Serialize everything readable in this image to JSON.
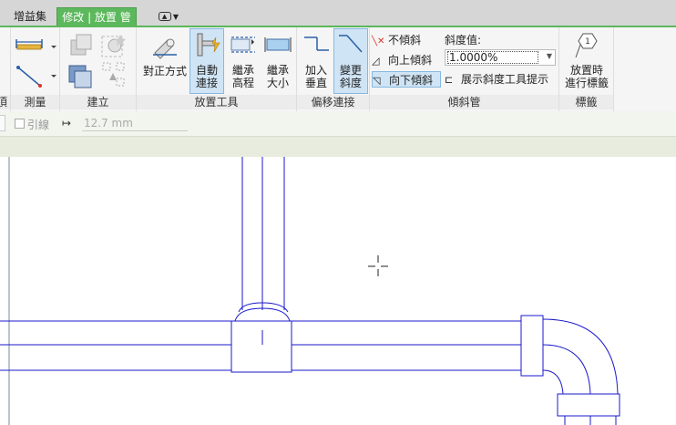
{
  "tabs": {
    "addins": "增益集",
    "modify": "修改 | 放置 管"
  },
  "ribbon": {
    "measure_label": "測量",
    "create_label": "建立",
    "clip_label": "頂",
    "placement_tools": {
      "label": "放置工具",
      "justification": "對正方式",
      "auto_connect_1": "自動",
      "auto_connect_2": "連接",
      "inherit_elev_1": "繼承",
      "inherit_elev_2": "高程",
      "inherit_size_1": "繼承",
      "inherit_size_2": "大小"
    },
    "offset_connections": {
      "label": "偏移連接",
      "add_vertical_1": "加入",
      "add_vertical_2": "垂直",
      "change_slope_1": "變更",
      "change_slope_2": "斜度"
    },
    "sloped_pipe": {
      "label": "傾斜管",
      "no_slope": "不傾斜",
      "slope_up": "向上傾斜",
      "slope_down": "向下傾斜",
      "slope_value_label": "斜度值:",
      "slope_value": "1.0000%",
      "show_tooltip": "展示斜度工具提示"
    },
    "tag": {
      "label": "標籤",
      "tag_on_place_1": "放置時",
      "tag_on_place_2": "進行標籤"
    }
  },
  "options_bar": {
    "leader_label": "引線",
    "leader_length": "12.7 mm"
  },
  "colors": {
    "tab_accent": "#5cb85c",
    "pipe_line": "#1a1acc",
    "active_button": "#cfe4f5"
  }
}
